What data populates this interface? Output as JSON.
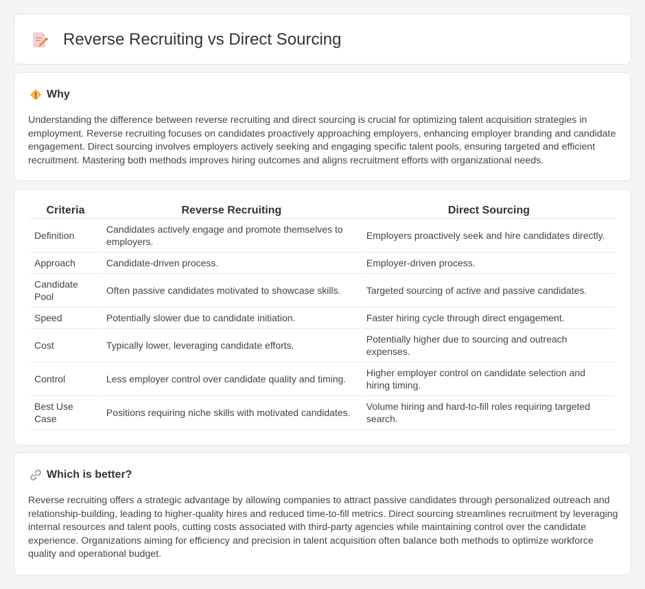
{
  "header": {
    "title": "Reverse Recruiting vs Direct Sourcing"
  },
  "why": {
    "title": "Why",
    "text": "Understanding the difference between reverse recruiting and direct sourcing is crucial for optimizing talent acquisition strategies in employment. Reverse recruiting focuses on candidates proactively approaching employers, enhancing employer branding and candidate engagement. Direct sourcing involves employers actively seeking and engaging specific talent pools, ensuring targeted and efficient recruitment. Mastering both methods improves hiring outcomes and aligns recruitment efforts with organizational needs."
  },
  "table": {
    "headers": [
      "Criteria",
      "Reverse Recruiting",
      "Direct Sourcing"
    ],
    "rows": [
      {
        "criteria": "Definition",
        "reverse": "Candidates actively engage and promote themselves to employers.",
        "direct": "Employers proactively seek and hire candidates directly."
      },
      {
        "criteria": "Approach",
        "reverse": "Candidate-driven process.",
        "direct": "Employer-driven process."
      },
      {
        "criteria": "Candidate Pool",
        "reverse": "Often passive candidates motivated to showcase skills.",
        "direct": "Targeted sourcing of active and passive candidates."
      },
      {
        "criteria": "Speed",
        "reverse": "Potentially slower due to candidate initiation.",
        "direct": "Faster hiring cycle through direct engagement."
      },
      {
        "criteria": "Cost",
        "reverse": "Typically lower, leveraging candidate efforts.",
        "direct": "Potentially higher due to sourcing and outreach expenses."
      },
      {
        "criteria": "Control",
        "reverse": "Less employer control over candidate quality and timing.",
        "direct": "Higher employer control on candidate selection and hiring timing."
      },
      {
        "criteria": "Best Use Case",
        "reverse": "Positions requiring niche skills with motivated candidates.",
        "direct": "Volume hiring and hard-to-fill roles requiring targeted search."
      }
    ]
  },
  "better": {
    "title": "Which is better?",
    "text": "Reverse recruiting offers a strategic advantage by allowing companies to attract passive candidates through personalized outreach and relationship-building, leading to higher-quality hires and reduced time-to-fill metrics. Direct sourcing streamlines recruitment by leveraging internal resources and talent pools, cutting costs associated with third-party agencies while maintaining control over the candidate experience. Organizations aiming for efficiency and precision in talent acquisition often balance both methods to optimize workforce quality and operational budget."
  },
  "icons": {
    "header": "document-pencil-icon",
    "why": "diamond-warning-icon",
    "better": "link-icon"
  }
}
